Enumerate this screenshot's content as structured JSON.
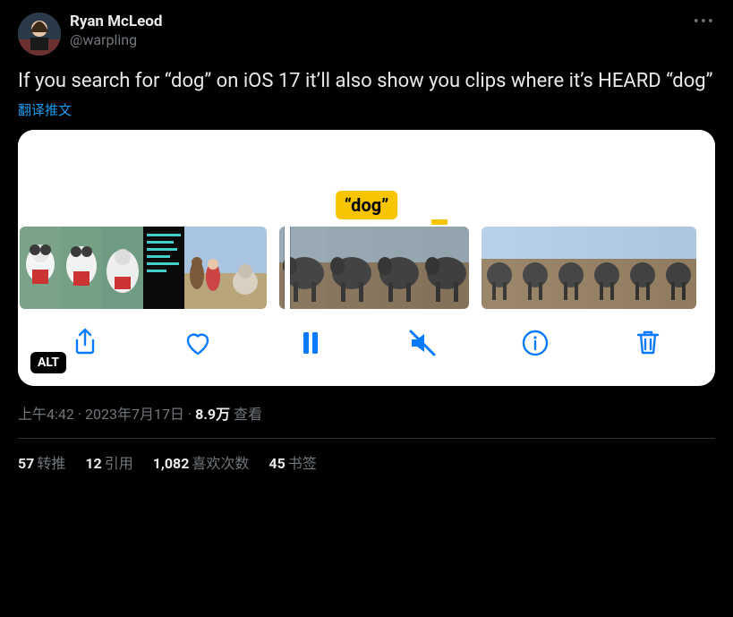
{
  "author": {
    "display_name": "Ryan McLeod",
    "handle": "@warpling"
  },
  "body_text": "If you search for “dog” on iOS 17 it’ll also show you clips where it’s HEARD “dog”",
  "translate_label": "翻译推文",
  "media": {
    "search_tag": "“dog”",
    "alt_badge": "ALT",
    "controls": {
      "share": "share",
      "like": "like",
      "pause": "pause",
      "mute": "mute",
      "info": "info",
      "trash": "trash"
    }
  },
  "meta": {
    "time": "上午4:42",
    "date": "2023年7月17日",
    "views_count": "8.9万",
    "views_label": "查看",
    "sep": " · "
  },
  "stats": {
    "retweets_n": "57",
    "retweets_label": "转推",
    "quotes_n": "12",
    "quotes_label": "引用",
    "likes_n": "1,082",
    "likes_label": "喜欢次数",
    "bookmarks_n": "45",
    "bookmarks_label": "书签"
  }
}
